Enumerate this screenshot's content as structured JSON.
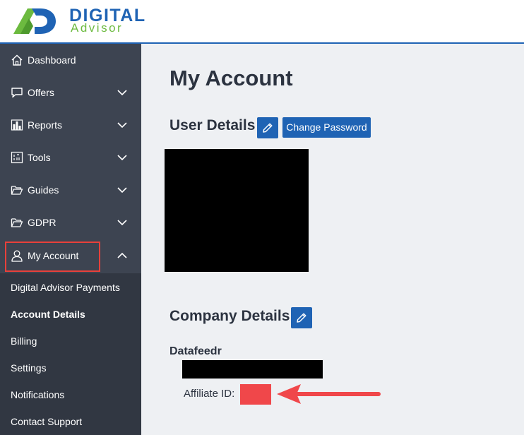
{
  "brand": {
    "line1": "DIGITAL",
    "line2": "Advisor"
  },
  "colors": {
    "accent": "#1f63b4",
    "logo_green": "#6cba3f",
    "sidebar": "#3d4451",
    "submenu": "#313742",
    "highlight": "#e8403a",
    "annotation": "#f0474a"
  },
  "sidebar": {
    "items": [
      {
        "label": "Dashboard",
        "icon": "home-icon"
      },
      {
        "label": "Offers",
        "icon": "chat-bubble-icon"
      },
      {
        "label": "Reports",
        "icon": "bar-chart-icon"
      },
      {
        "label": "Tools",
        "icon": "tools-grid-icon"
      },
      {
        "label": "Guides",
        "icon": "folder-icon"
      },
      {
        "label": "GDPR",
        "icon": "folder-icon"
      },
      {
        "label": "My Account",
        "icon": "user-icon"
      }
    ],
    "submenu": [
      {
        "label": "Digital Advisor Payments"
      },
      {
        "label": "Account Details"
      },
      {
        "label": "Billing"
      },
      {
        "label": "Settings"
      },
      {
        "label": "Notifications"
      },
      {
        "label": "Contact Support"
      }
    ]
  },
  "main": {
    "title": "My Account",
    "user_details_title": "User Details",
    "change_password_label": "Change Password",
    "company_details_title": "Company Details",
    "company_name": "Datafeedr",
    "affiliate_label": "Affiliate ID:"
  }
}
